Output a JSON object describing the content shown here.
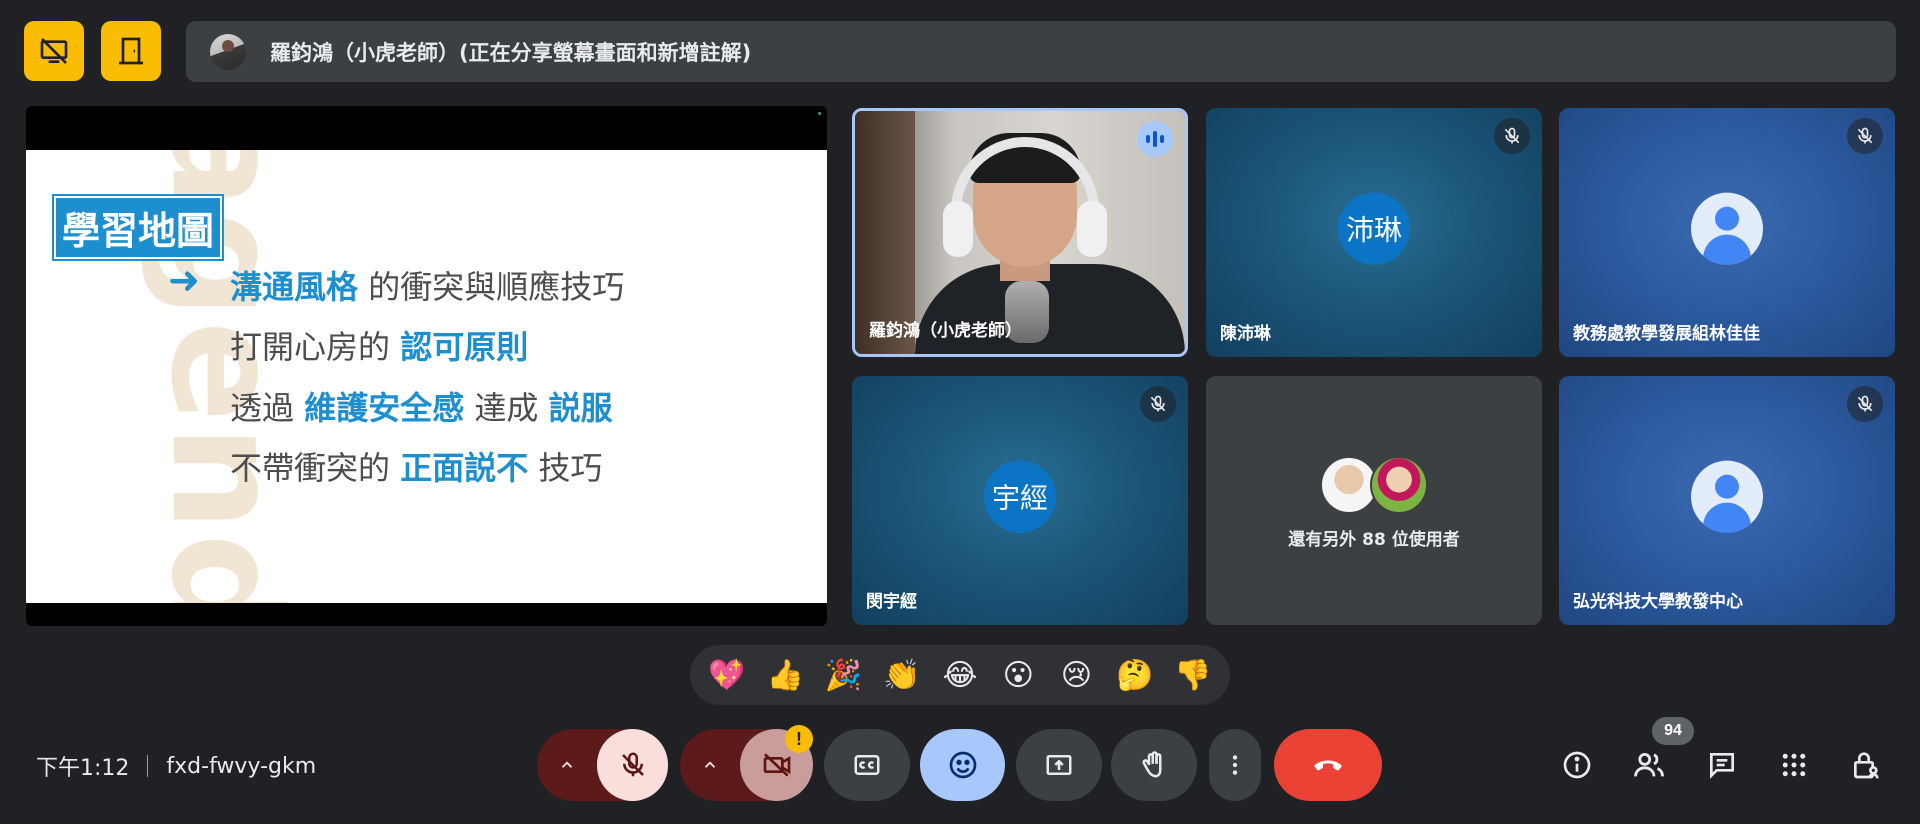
{
  "top_bar": {
    "presenter_text": "羅鈞鴻（小虎老師）(正在分享螢幕畫面和新增註解)"
  },
  "shared_screen": {
    "background_word": "agenda",
    "title": "學習地圖",
    "arrow": "➜",
    "lines": [
      [
        {
          "t": "溝通風格",
          "hl": true
        },
        {
          "t": " 的衝突與順應技巧",
          "hl": false
        }
      ],
      [
        {
          "t": "打開心房的 ",
          "hl": false
        },
        {
          "t": "認可原則",
          "hl": true
        }
      ],
      [
        {
          "t": "透過 ",
          "hl": false
        },
        {
          "t": "維護安全感",
          "hl": true
        },
        {
          "t": " 達成 ",
          "hl": false
        },
        {
          "t": "説服",
          "hl": true
        }
      ],
      [
        {
          "t": "不帶衝突的 ",
          "hl": false
        },
        {
          "t": "正面説不",
          "hl": true
        },
        {
          "t": " 技巧",
          "hl": false
        }
      ]
    ],
    "highlight_color": "#1d8fcf"
  },
  "tiles": [
    {
      "name": "羅鈞鴻（小虎老師）",
      "type": "video",
      "speaking": true
    },
    {
      "name": "陳沛琳",
      "type": "initials",
      "initials": "沛琳",
      "muted": true
    },
    {
      "name": "教務處教學發展組林佳佳",
      "type": "avatar",
      "muted": true
    },
    {
      "name": "閔宇經",
      "type": "initials",
      "initials": "宇經",
      "muted": true
    },
    {
      "name": "",
      "type": "others",
      "others_text": "還有另外 88 位使用者"
    },
    {
      "name": "弘光科技大學教發中心",
      "type": "avatar",
      "muted": true
    }
  ],
  "reactions": [
    "💖",
    "👍",
    "🎉",
    "👏",
    "😂",
    "😮",
    "😢",
    "🤔",
    "👎"
  ],
  "bottom_bar": {
    "time": "下午1:12",
    "meeting_code": "fxd-fwvy-gkm",
    "camera_warning": "!",
    "people_count": "94"
  },
  "colors": {
    "background": "#202124",
    "accent_yellow": "#fbbc04",
    "end_call": "#ea4335",
    "active_blue": "#a8c7fa"
  },
  "icons": {
    "top_left_1": "screen-share-off-icon",
    "top_left_2": "exit-presentation-icon",
    "controls": [
      "chevron-up-icon",
      "mic-off-icon",
      "chevron-up-icon",
      "camera-off-icon",
      "captions-icon",
      "emoji-icon",
      "present-screen-icon",
      "raise-hand-icon",
      "more-vert-icon",
      "end-call-icon"
    ],
    "right": [
      "info-icon",
      "people-icon",
      "chat-icon",
      "apps-icon",
      "host-controls-icon"
    ]
  }
}
